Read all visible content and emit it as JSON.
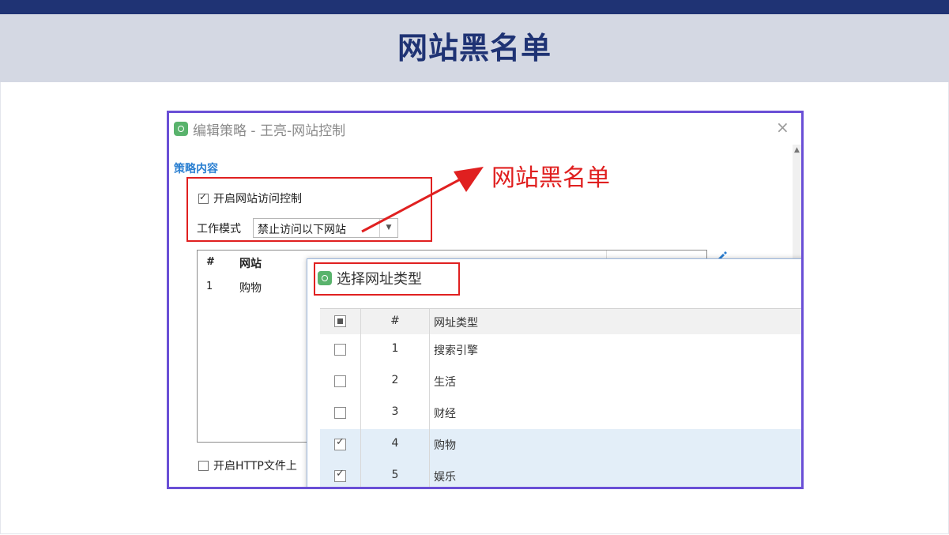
{
  "slide": {
    "title": "网站黑名单"
  },
  "dialog": {
    "title": "编辑策略 - 王亮-网站控制",
    "close_glyph": "×",
    "section_title": "策略内容",
    "enable_access_control": {
      "label": "开启网站访问控制",
      "checked": true
    },
    "work_mode": {
      "label": "工作模式",
      "value": "禁止访问以下网站",
      "arrow": "▼"
    },
    "site_list": {
      "columns": [
        "#",
        "网站"
      ],
      "rows": [
        {
          "num": "1",
          "site": "购物"
        }
      ]
    },
    "http_upload": {
      "label": "开启HTTP文件上",
      "checked": false
    }
  },
  "callout": {
    "text": "网站黑名单",
    "color": "#e02020"
  },
  "popup": {
    "title": "选择网址类型",
    "columns": {
      "num": "#",
      "type": "网址类型"
    },
    "rows": [
      {
        "num": "1",
        "type": "搜索引擎",
        "checked": false
      },
      {
        "num": "2",
        "type": "生活",
        "checked": false
      },
      {
        "num": "3",
        "type": "财经",
        "checked": false
      },
      {
        "num": "4",
        "type": "购物",
        "checked": true
      },
      {
        "num": "5",
        "type": "娱乐",
        "checked": true
      }
    ]
  },
  "colors": {
    "navy": "#1f3374",
    "header_bg": "#d4d8e3",
    "frame": "#6a4fd6",
    "highlight": "#e02020",
    "selected_row": "#e3eef8"
  }
}
